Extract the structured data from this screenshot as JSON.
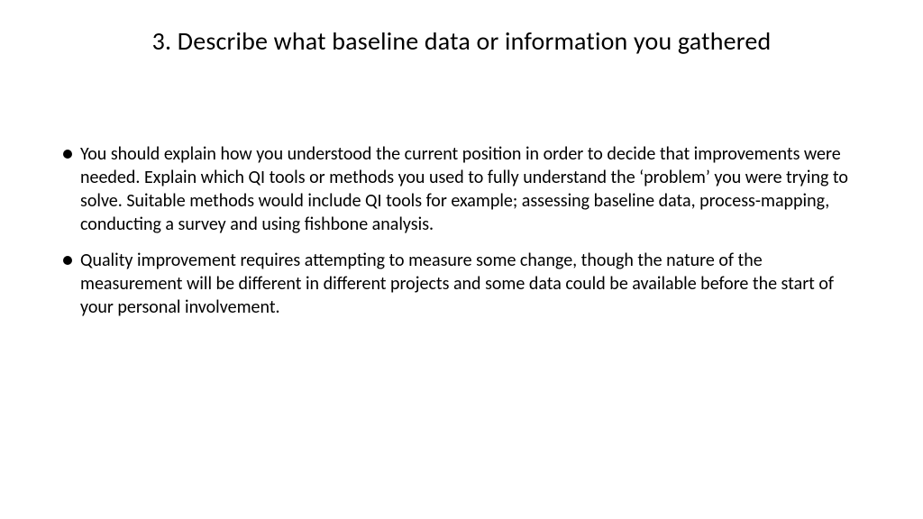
{
  "slide": {
    "title": "3. Describe what baseline data or information you gathered",
    "bullets": [
      "You should explain how you understood the current position in order to decide that improvements were needed. Explain which QI tools or methods you used to fully understand the ‘problem’ you were trying to solve. Suitable methods would include QI tools for example; assessing baseline data, process-mapping, conducting a survey and using fishbone analysis.",
      "Quality improvement requires attempting to measure some change, though the nature of the measurement will be different in different projects and some data could be available before the start of your personal involvement."
    ]
  }
}
